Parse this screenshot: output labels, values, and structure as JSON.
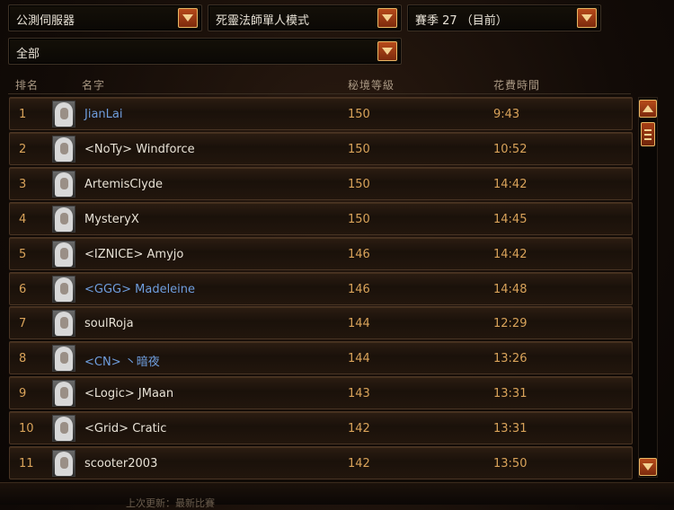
{
  "filters": {
    "region": "公測伺服器",
    "mode": "死靈法師單人模式",
    "season": "賽季 27 （目前）",
    "category": "全部"
  },
  "columns": {
    "rank": "排名",
    "name": "名字",
    "level": "秘境等級",
    "time": "花費時間"
  },
  "rows": [
    {
      "rank": "1",
      "name": "JianLai",
      "level": "150",
      "time": "9:43",
      "link": true
    },
    {
      "rank": "2",
      "name": "<NoTy> Windforce",
      "level": "150",
      "time": "10:52",
      "link": false
    },
    {
      "rank": "3",
      "name": "ArtemisClyde",
      "level": "150",
      "time": "14:42",
      "link": false
    },
    {
      "rank": "4",
      "name": "MysteryX",
      "level": "150",
      "time": "14:45",
      "link": false
    },
    {
      "rank": "5",
      "name": "<IZNICE> Amyjo",
      "level": "146",
      "time": "14:42",
      "link": false
    },
    {
      "rank": "6",
      "name": "<GGG> Madeleine",
      "level": "146",
      "time": "14:48",
      "link": true
    },
    {
      "rank": "7",
      "name": "soulRoja",
      "level": "144",
      "time": "12:29",
      "link": false
    },
    {
      "rank": "8",
      "name": "<CN> 丶暗夜",
      "level": "144",
      "time": "13:26",
      "link": true
    },
    {
      "rank": "9",
      "name": "<Logic> JMaan",
      "level": "143",
      "time": "13:31",
      "link": false
    },
    {
      "rank": "10",
      "name": "<Grid> Cratic",
      "level": "142",
      "time": "13:31",
      "link": false
    },
    {
      "rank": "11",
      "name": "scooter2003",
      "level": "142",
      "time": "13:50",
      "link": false
    }
  ],
  "footer": {
    "text": "上次更新：最新比賽"
  },
  "colors": {
    "gold": "#d9a35a",
    "link": "#6f9ede",
    "button": "#b64a1a"
  },
  "icons": {
    "dropdown": "chevron-down-icon",
    "scroll_up": "arrow-up-icon",
    "scroll_down": "arrow-down-icon",
    "avatar": "necromancer-portrait-icon"
  }
}
